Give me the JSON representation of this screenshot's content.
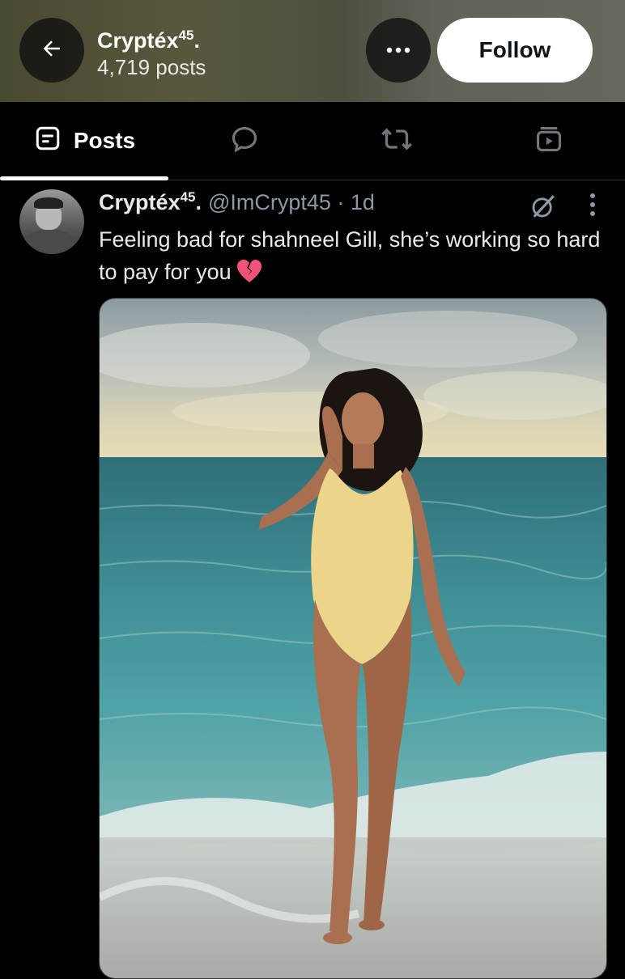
{
  "header": {
    "name": "Cryptéx",
    "name_sup": "45",
    "name_suffix": ".",
    "posts_count": "4,719 posts",
    "follow_label": "Follow"
  },
  "tabs": {
    "posts_label": "Posts"
  },
  "post": {
    "author_name": "Cryptéx",
    "author_sup": "45",
    "author_suffix": ".",
    "handle_time": "@ImCrypt45 · 1d",
    "text": "Feeling bad for shahneel Gill, she’s working so hard to pay for you"
  },
  "icons": {
    "back": "arrow-left-icon",
    "more": "more-horizontal-icon",
    "posts_tab": "posts-list-icon",
    "replies_tab": "speech-bubble-icon",
    "reposts_tab": "repost-icon",
    "media_tab": "media-play-icon",
    "grok": "grok-icon",
    "post_more": "more-vertical-icon",
    "emoji": "broken-heart-emoji"
  },
  "colors": {
    "background": "#000000",
    "text_primary": "#e7e9ea",
    "text_secondary": "#8b98a5",
    "follow_bg": "#ffffff",
    "broken_heart": "#f0537a"
  }
}
